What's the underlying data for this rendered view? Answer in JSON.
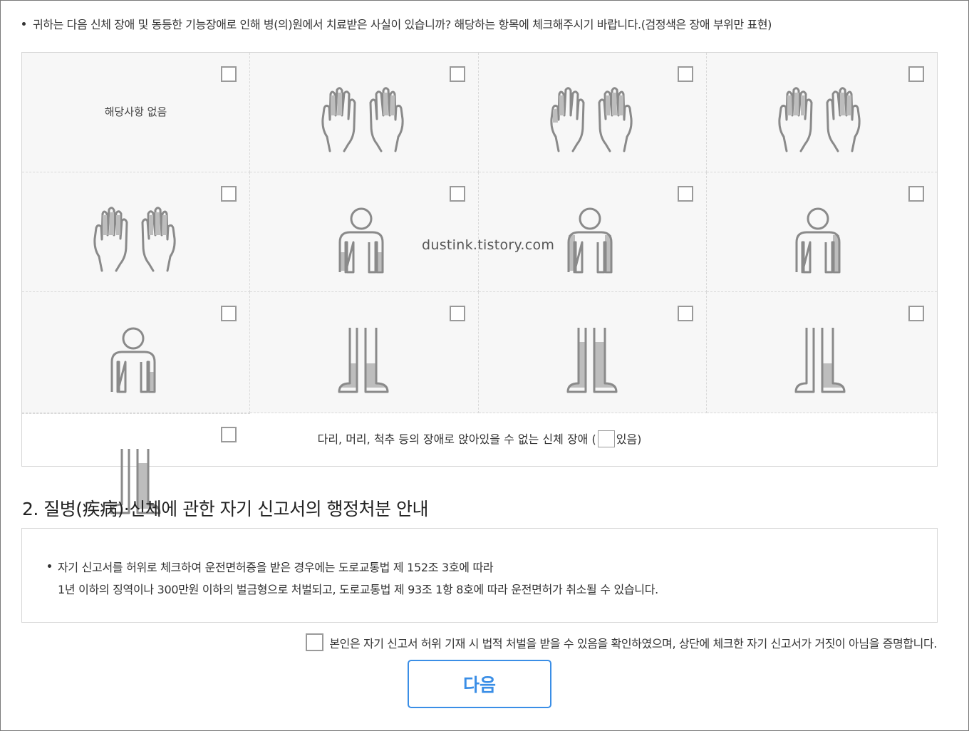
{
  "question": {
    "text": "귀하는 다음 신체 장애 및 동등한 기능장애로 인해 병(의)원에서 치료받은 사실이 있습니까? 해당하는 항목에 체크해주시기 바랍니다.(검정색은 장애 부위만 표현)"
  },
  "grid": {
    "none_label": "해당사항 없음",
    "cells": [
      {
        "icon": "none-text",
        "checked": false
      },
      {
        "icon": "hands-icon-variant-1",
        "checked": false
      },
      {
        "icon": "hands-icon-variant-2",
        "checked": false
      },
      {
        "icon": "hands-icon-variant-3",
        "checked": false
      },
      {
        "icon": "arms-icon-variant-1",
        "checked": false
      },
      {
        "icon": "arms-icon-variant-2",
        "checked": false
      },
      {
        "icon": "arms-icon-variant-3",
        "checked": false
      },
      {
        "icon": "arms-icon-variant-4",
        "checked": false
      },
      {
        "icon": "legs-icon-variant-1",
        "checked": false
      },
      {
        "icon": "legs-icon-variant-2",
        "checked": false
      },
      {
        "icon": "legs-icon-variant-3",
        "checked": false
      },
      {
        "icon": "legs-icon-variant-4",
        "checked": false
      }
    ],
    "bottom_prefix": "다리, 머리, 척추 등의 장애로 앉아있을 수 없는 신체 장애 (",
    "bottom_suffix": "있음)"
  },
  "watermark": "dustink.tistory.com",
  "section": {
    "title": "2. 질병(疾病)·신체에 관한 자기 신고서의 행정처분 안내"
  },
  "notice": {
    "line1": "자기 신고서를 허위로 체크하여 운전면허증을 받은 경우에는 도로교통법 제 152조 3호에 따라",
    "line2": "1년 이하의 징역이나 300만원 이하의 벌금형으로 처벌되고, 도로교통법 제 93조 1항 8호에 따라 운전면허가 취소될 수 있습니다."
  },
  "confirm": {
    "label": "본인은 자기 신고서 허위 기재 시 법적 처벌을 받을 수 있음을 확인하였으며, 상단에 체크한 자기 신고서가 거짓이 아님을 증명합니다."
  },
  "next_button": {
    "label": "다음"
  },
  "colors": {
    "accent": "#3a8ee6",
    "icon_stroke": "#8a8a8a",
    "icon_fill": "#bdbdbd",
    "cell_bg": "#f7f7f7"
  }
}
